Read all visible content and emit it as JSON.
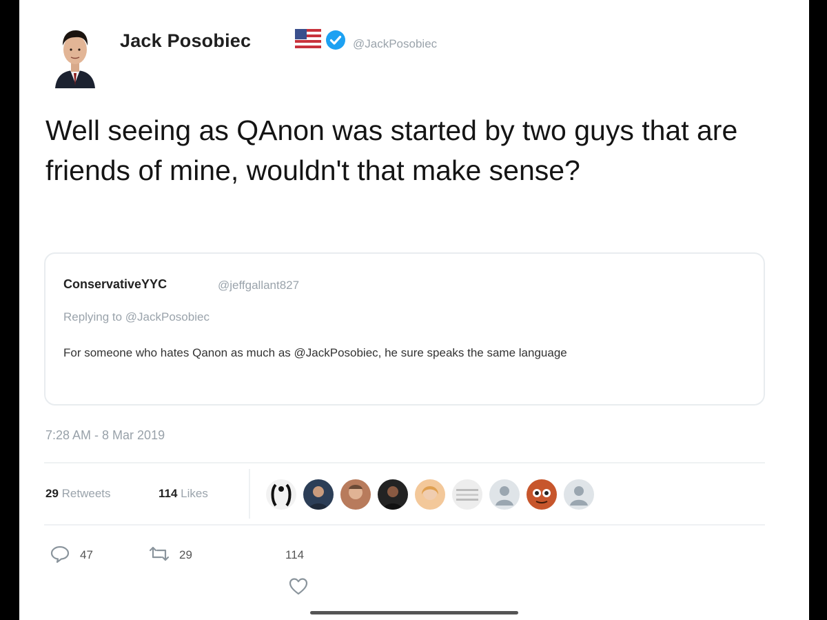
{
  "tweet": {
    "author_name": "Jack Posobiec",
    "author_handle": "@JackPosobiec",
    "text": "Well seeing as QAnon was started by two guys that are friends of mine, wouldn't that make sense?",
    "timestamp": "7:28 AM - 8 Mar 2019",
    "retweets_count": "29",
    "retweets_label": "Retweets",
    "likes_count": "114",
    "likes_label": "Likes",
    "reply_action_count": "47",
    "retweet_action_count": "29",
    "like_action_count": "114"
  },
  "quoted": {
    "name": "ConservativeYYC",
    "handle": "@jeffgallant827",
    "reply_prefix": "Replying to",
    "reply_handle": "@JackPosobiec",
    "text": "For someone who hates Qanon as much as @JackPosobiec, he sure speaks the same language"
  },
  "icons": {
    "verified": "verified-badge-icon",
    "flag": "us-flag-icon",
    "reply": "reply-icon",
    "retweet": "retweet-icon",
    "like": "heart-icon"
  },
  "colors": {
    "verified": "#1da1f2",
    "muted_text": "#9aa3ab",
    "border": "#e8ecef"
  }
}
